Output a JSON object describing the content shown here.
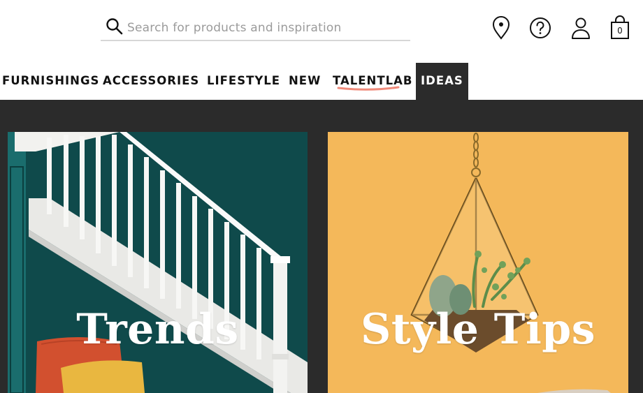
{
  "search": {
    "placeholder": "Search for products and inspiration",
    "icon": "search-icon"
  },
  "header_icons": [
    {
      "name": "store-locator-icon"
    },
    {
      "name": "help-icon"
    },
    {
      "name": "account-icon"
    },
    {
      "name": "cart-icon",
      "count": "0"
    }
  ],
  "nav": {
    "items": [
      {
        "label": "FURNISHINGS"
      },
      {
        "label": "ACCESSORIES"
      },
      {
        "label": "LIFESTYLE"
      },
      {
        "label": "NEW"
      },
      {
        "label": "TALENTLAB"
      },
      {
        "label": "IDEAS"
      }
    ],
    "active": "IDEAS"
  },
  "cards": [
    {
      "title": "Trends"
    },
    {
      "title": "Style Tips"
    }
  ],
  "colors": {
    "accent_underline": "#f08a7a",
    "nav_active_bg": "#2b2b2b",
    "content_bg": "#2b2b2b",
    "trends_wall": "#0e4a4a",
    "style_tips_bg": "#f3b356"
  }
}
